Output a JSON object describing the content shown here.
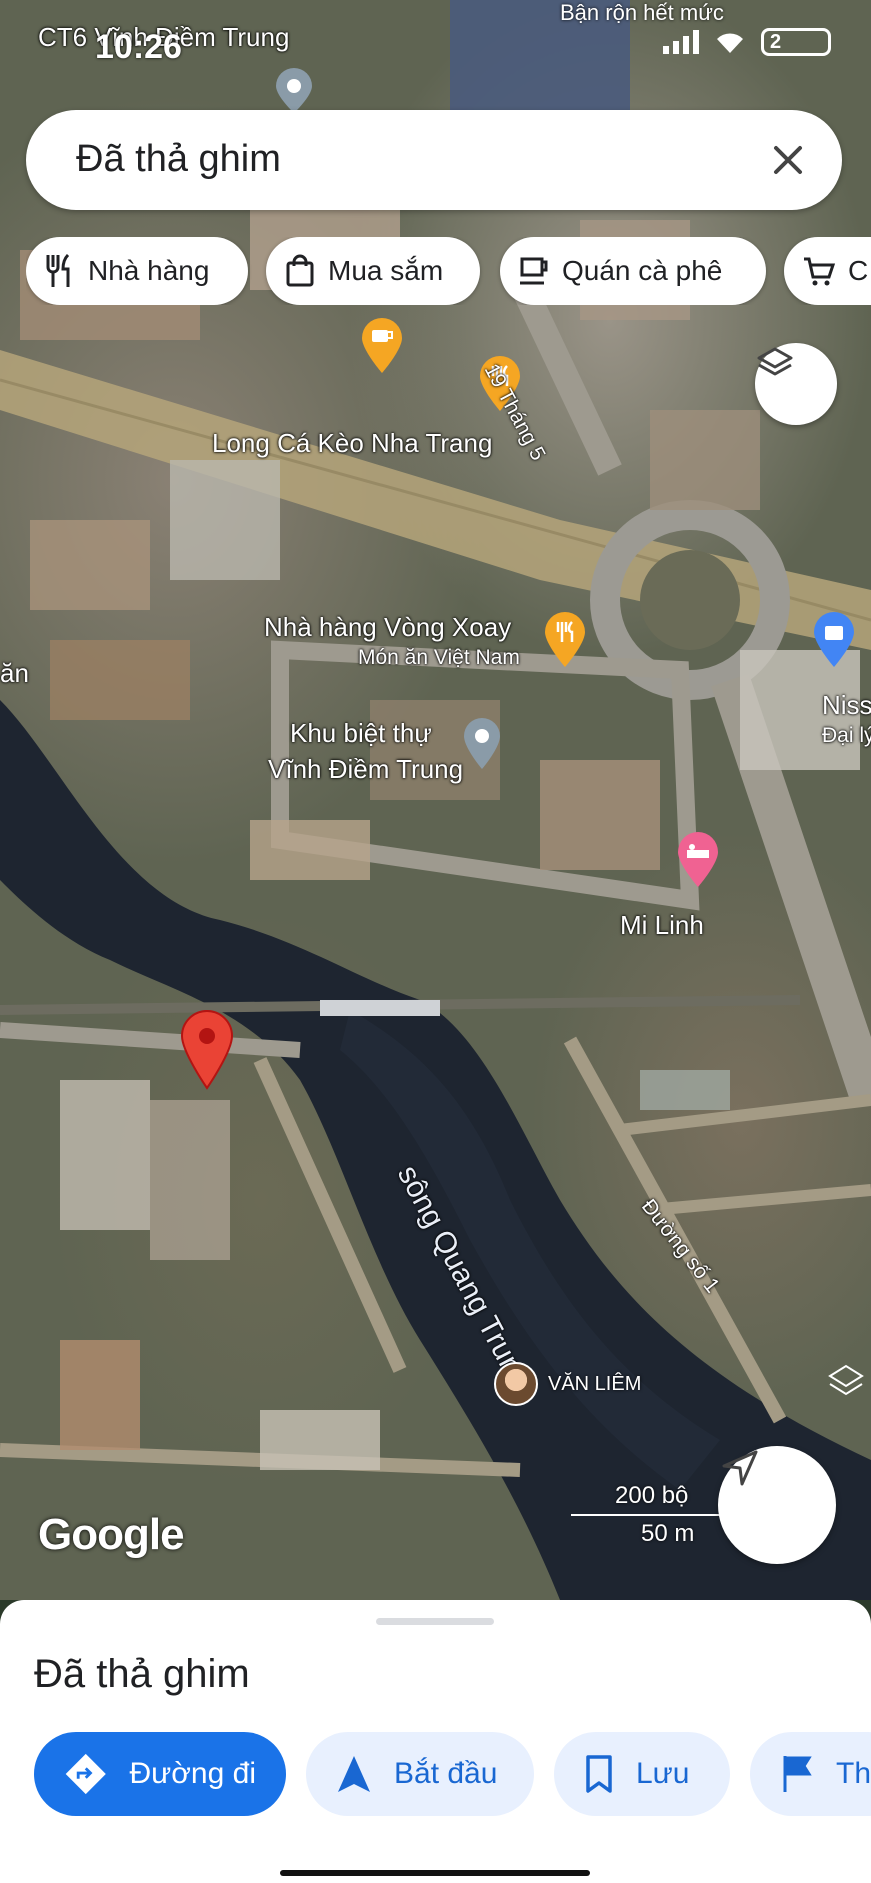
{
  "status_bar": {
    "time": "10:26",
    "battery": "2",
    "banner": "Bận rộn hết mức"
  },
  "search": {
    "value": "Đã thả ghim"
  },
  "chips": [
    {
      "label": "Nhà hàng",
      "icon": "restaurant-icon"
    },
    {
      "label": "Mua sắm",
      "icon": "shopping-bag-icon"
    },
    {
      "label": "Quán cà phê",
      "icon": "coffee-icon"
    },
    {
      "label": "C",
      "icon": "shopping-cart-icon"
    }
  ],
  "map_labels": {
    "top_place": "CT6 Vĩnh Điềm Trung",
    "street_19_5": "19 Tháng 5",
    "long_ca_keo": "Long Cá Kèo Nha Trang",
    "nha_hang_vong_xoay": "Nhà hàng Vòng Xoay",
    "mon_an": "Món ăn Việt Nam",
    "khu_biet_thu_1": "Khu biệt thự",
    "khu_biet_thu_2": "Vĩnh Điềm Trung",
    "nissan_1": "Niss",
    "nissan_2": "Đại lý",
    "left_edge": "ăn",
    "mi_linh": "Mi Linh",
    "river": "sông Quang Trung",
    "duong_so_1": "Đường số 1",
    "user": "VĂN LIÊM"
  },
  "google_logo": "Google",
  "scale": {
    "feet": "200 bộ",
    "meters": "50 m"
  },
  "sheet": {
    "title": "Đã thả ghim",
    "actions": [
      {
        "label": "Đường đi",
        "icon": "directions-icon"
      },
      {
        "label": "Bắt đầu",
        "icon": "navigation-arrow-icon"
      },
      {
        "label": "Lưu",
        "icon": "bookmark-icon"
      },
      {
        "label": "Th",
        "icon": "flag-icon"
      }
    ]
  },
  "colors": {
    "accent": "#1a73e8",
    "pin": "#ea4335",
    "poi_orange": "#f5a623",
    "water": "#1e2530"
  }
}
